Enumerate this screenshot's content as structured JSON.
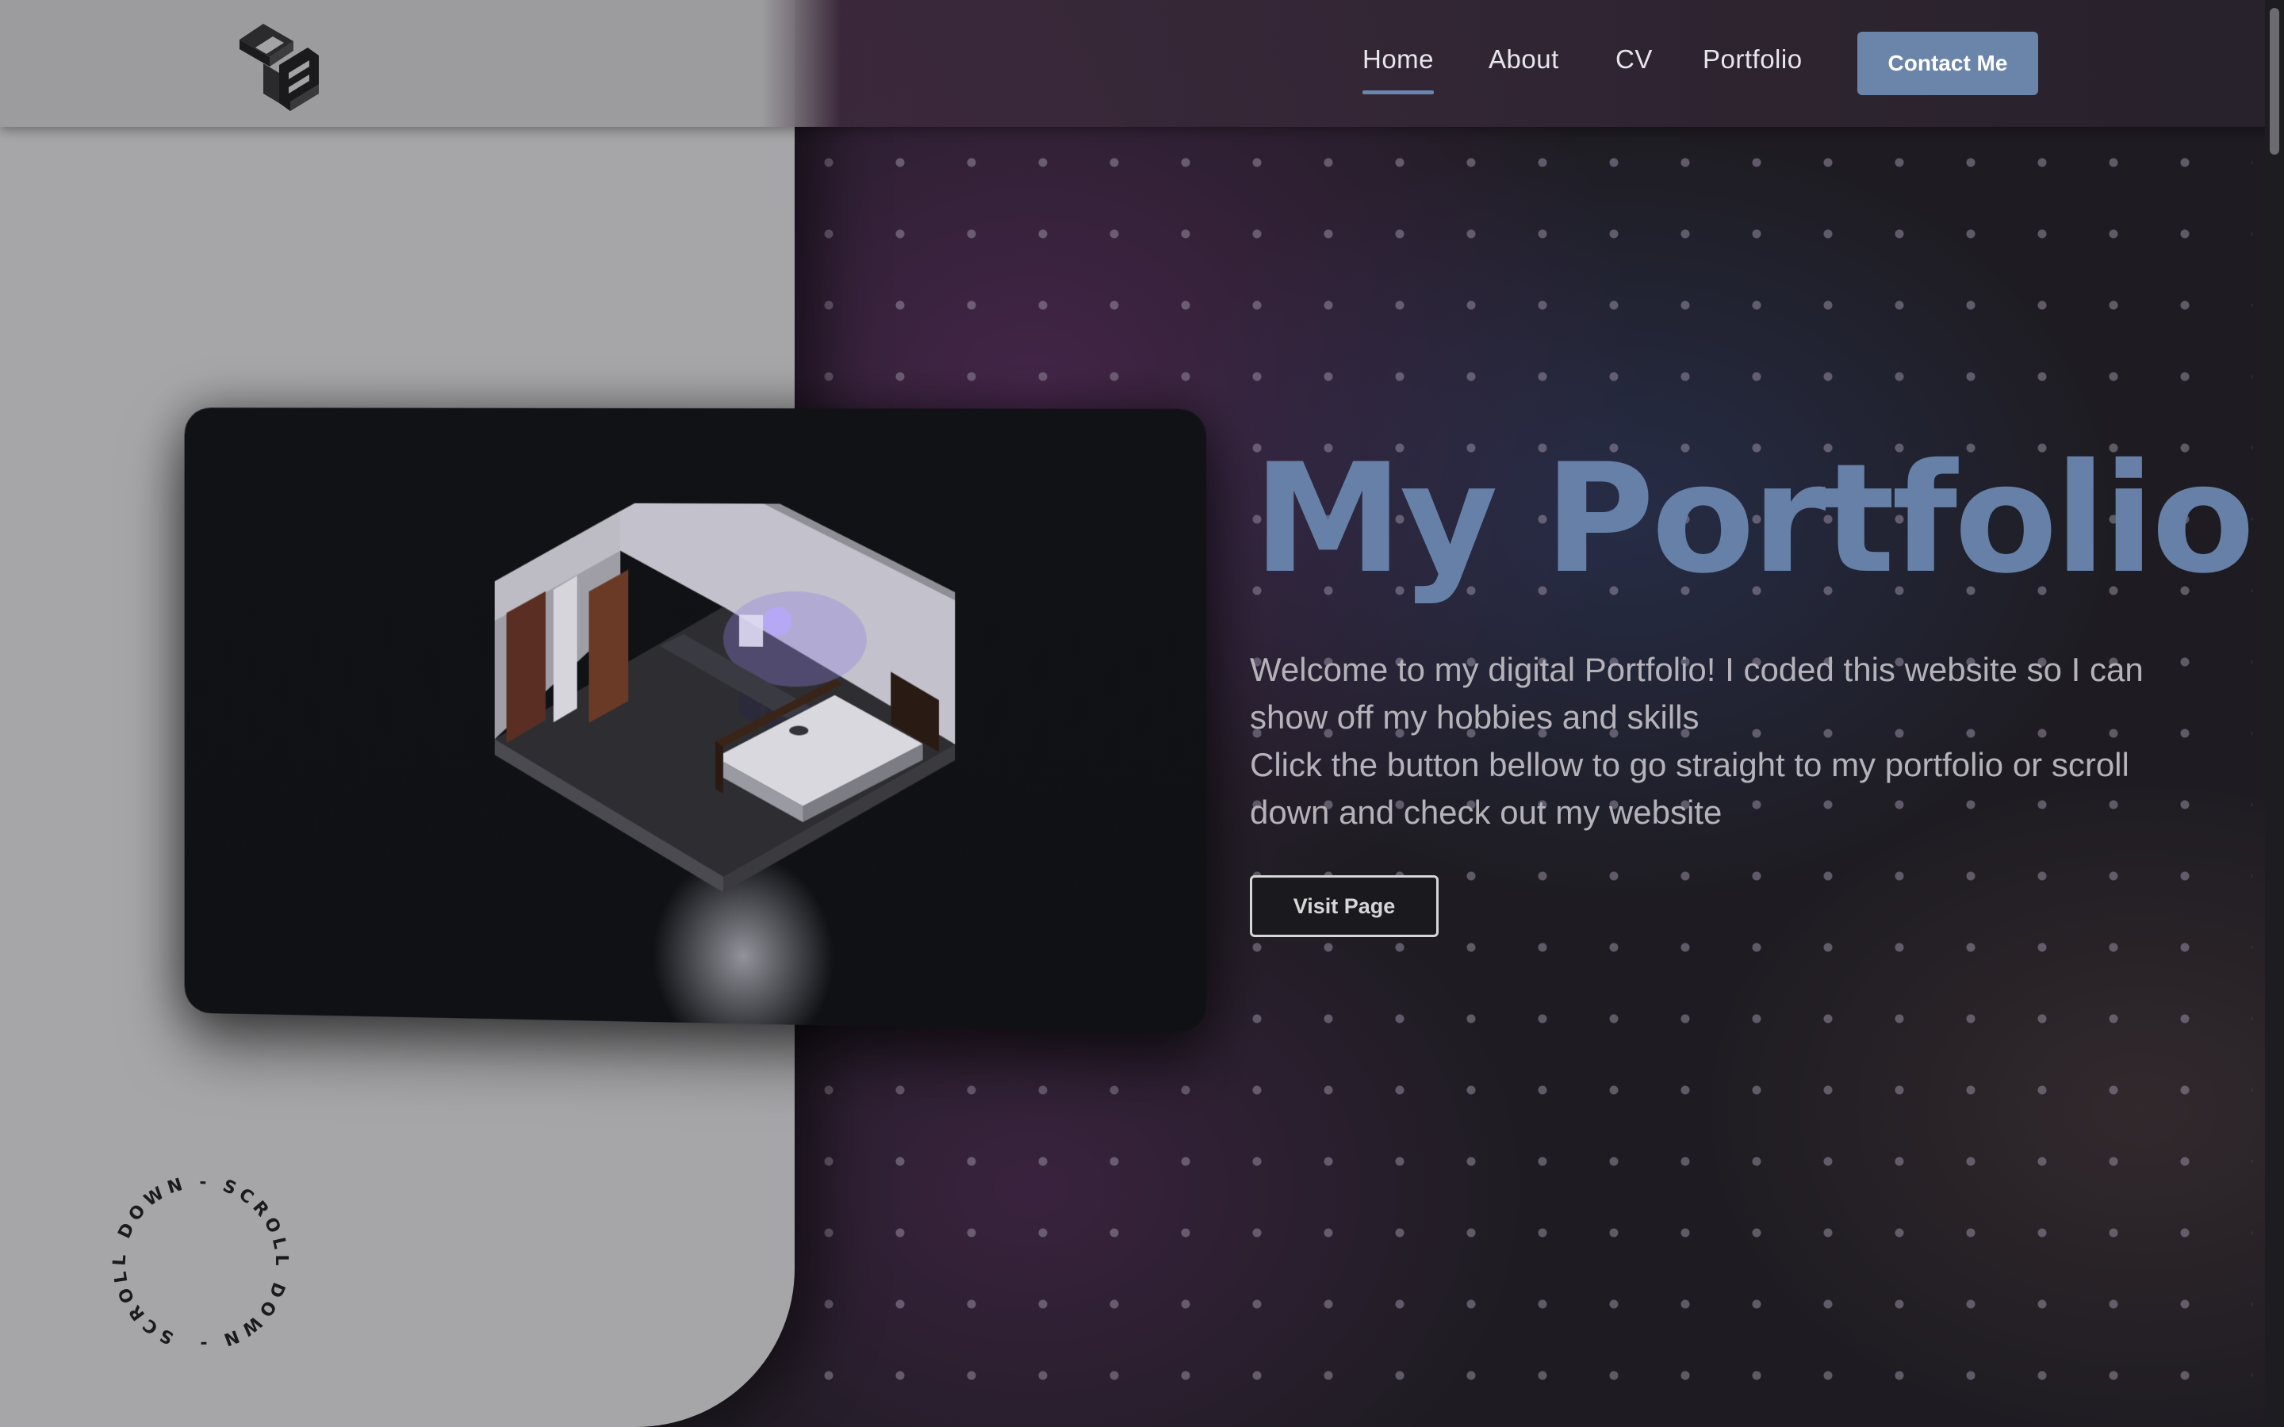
{
  "header": {
    "logo_icon": "ue-cube-logo-icon",
    "nav": [
      {
        "label": "Home",
        "active": true
      },
      {
        "label": "About",
        "active": false
      },
      {
        "label": "CV",
        "active": false
      },
      {
        "label": "Portfolio",
        "active": false
      }
    ],
    "contact_label": "Contact Me"
  },
  "hero": {
    "image_icon": "isometric-bedroom-render",
    "title": "My Portfolio",
    "line1": "Welcome to my digital Portfolio! I coded this website so I can show off my hobbies and skills",
    "line2": "Click the button bellow to go straight to my portfolio or scroll down and check out my website",
    "button_label": "Visit Page"
  },
  "scroll_indicator": {
    "text": "SCROLL DOWN - SCROLL DOWN - "
  },
  "colors": {
    "accent": "#6a84aa",
    "left_panel": "#a6a6a8",
    "background": "#1e1c22"
  }
}
